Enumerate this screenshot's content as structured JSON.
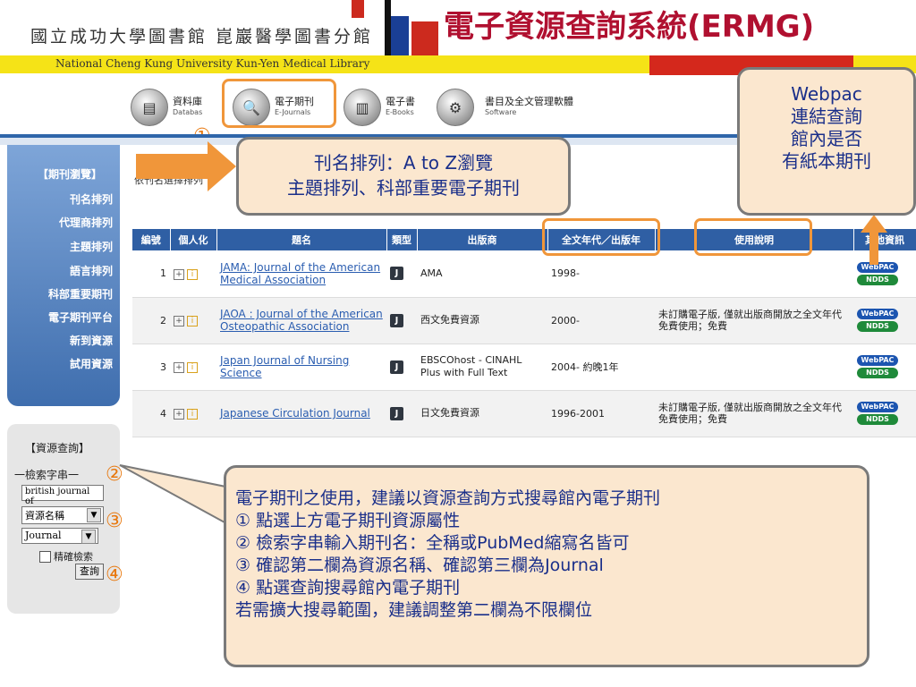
{
  "header": {
    "library_name": "國立成功大學圖書館 崑巖醫學圖書分館",
    "system_title": "電子資源查詢系統(ERMG)",
    "library_name_en": "National Cheng Kung University Kun-Yen Medical Library"
  },
  "tabs": [
    {
      "zh": "資料庫",
      "en": "Databas",
      "icon": "database-icon"
    },
    {
      "zh": "電子期刊",
      "en": "E-Journals",
      "icon": "ejournals-icon"
    },
    {
      "zh": "電子書",
      "en": "E-Books",
      "icon": "ebooks-icon"
    },
    {
      "zh": "書目及全文管理軟體",
      "en": "Software",
      "icon": "software-icon"
    }
  ],
  "step_marks": {
    "s1": "①",
    "s2": "②",
    "s3": "③",
    "s4": "④"
  },
  "sidebar": {
    "group_title": "【期刊瀏覽】",
    "items": [
      "刊名排列",
      "代理商排列",
      "主題排列",
      "語言排列",
      "科部重要期刊",
      "電子期刊平台",
      "新到資源",
      "試用資源"
    ]
  },
  "search": {
    "title": "【資源查詢】",
    "label": "一檢索字串一",
    "query": "british journal of",
    "field_select": "資源名稱",
    "type_select": "Journal",
    "exact_label": "精確檢索",
    "button": "查詢"
  },
  "breadcrumb": "依刊名選擇排列",
  "table": {
    "headers": [
      "編號",
      "個人化",
      "題名",
      "類型",
      "出版商",
      "全文年代／出版年",
      "使用說明",
      "其他資訊"
    ],
    "rows": [
      {
        "no": "1",
        "title": "JAMA: Journal of the American Medical Association",
        "type": "J",
        "publisher": "AMA",
        "years": "1998-",
        "note": ""
      },
      {
        "no": "2",
        "title": "JAOA : Journal of the American Osteopathic Association",
        "type": "J",
        "publisher": "西文免費資源",
        "years": "2000-",
        "note": "未訂購電子版, 僅就出版商開放之全文年代免費使用；免費"
      },
      {
        "no": "3",
        "title": "Japan Journal of Nursing Science",
        "type": "J",
        "publisher": "EBSCOhost - CINAHL Plus with Full Text",
        "years": "2004- 約晚1年",
        "note": ""
      },
      {
        "no": "4",
        "title": "Japanese Circulation Journal",
        "type": "J",
        "publisher": "日文免費資源",
        "years": "1996-2001",
        "note": "未訂購電子版, 僅就出版商開放之全文年代免費使用；免費"
      }
    ],
    "badges": {
      "webpac": "WebPAC",
      "ndds": "NDDS"
    }
  },
  "callouts": {
    "az": [
      "刊名排列：A to Z瀏覽",
      "主題排列、科部重要電子期刊"
    ],
    "webpac": [
      "Webpac",
      "連結查詢",
      "館內是否",
      "有紙本期刊"
    ],
    "main": [
      "電子期刊之使用，建議以資源查詢方式搜尋館內電子期刊",
      "①  點選上方電子期刊資源屬性",
      "②  檢索字串輸入期刊名：全稱或PubMed縮寫名皆可",
      "③  確認第二欄為資源名稱、確認第三欄為Journal",
      "④  點選查詢搜尋館內電子期刊",
      "若需擴大搜尋範圍，建議調整第二欄為不限欄位"
    ]
  },
  "colors": {
    "accent_orange": "#f0963a",
    "title_red": "#b01030",
    "nav_blue": "#2f5fa4",
    "callout_text": "#1a2f8a",
    "callout_bg": "#fbe7cf"
  }
}
